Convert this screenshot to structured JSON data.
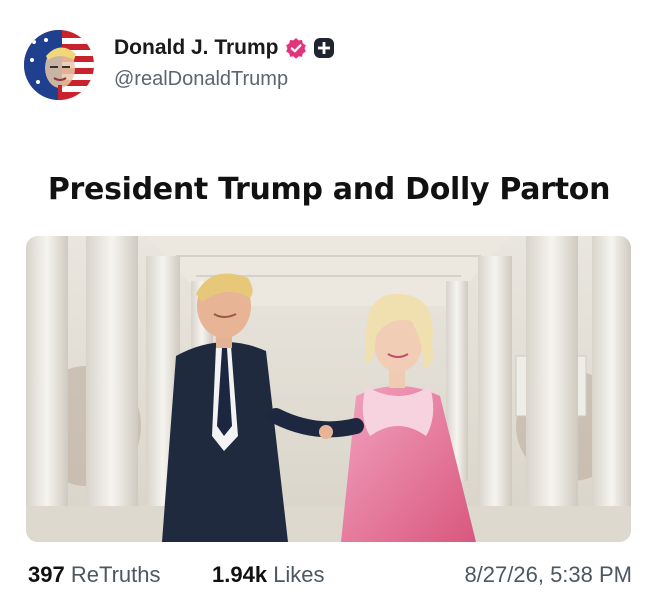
{
  "author": {
    "display_name": "Donald J. Trump",
    "handle": "@realDonaldTrump"
  },
  "post": {
    "title": "President Trump and Dolly Parton",
    "retruths_count": "397",
    "retruths_label": "ReTruths",
    "likes_count": "1.94k",
    "likes_label": "Likes",
    "timestamp": "8/27/26, 5:38 PM"
  },
  "icons": {
    "verified": "verified-badge-icon",
    "follow": "add-follow-icon"
  },
  "colors": {
    "verified": "#e2347d",
    "follow": "#1f2430",
    "text_secondary": "#5b6470"
  }
}
